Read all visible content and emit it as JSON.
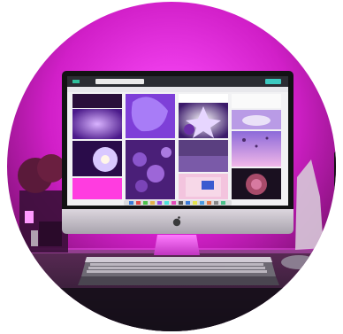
{
  "scene": {
    "subject": "desktop-computer-on-desk",
    "lighting_color": "#d61ad6",
    "glow_color": "#ff3cff",
    "screen_content": "image-moodboard-grid"
  },
  "colors": {
    "background_outside_circle": "#ffffff",
    "wall": "#b0159e",
    "desk": "#2a2230",
    "monitor_bezel": "#1a1a1c",
    "monitor_chin": "#c9c6cc",
    "keyboard": "#8a8790",
    "accent_purple": "#7a2fbf"
  },
  "icons": [
    "apple-logo-icon"
  ]
}
